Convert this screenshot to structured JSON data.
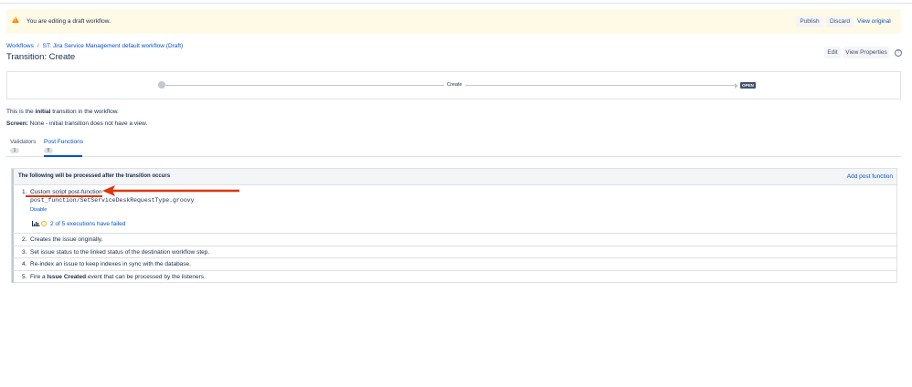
{
  "banner": {
    "text": "You are editing a draft workflow.",
    "publish": "Publish",
    "discard": "Discard",
    "view_original": "View original"
  },
  "breadcrumb": {
    "root": "Workflows",
    "sep": "/",
    "workflow": "ST: Jira Service Management default workflow (Draft)"
  },
  "header": {
    "title": "Transition: Create",
    "edit": "Edit",
    "view_properties": "View Properties",
    "help": "?"
  },
  "diagram": {
    "transition": "Create",
    "status": "OPEN"
  },
  "info": {
    "initial_prefix": "This is the ",
    "initial_bold": "initial",
    "initial_suffix": " transition in the workflow.",
    "screen_label": "Screen:",
    "screen_value": " None - initial transition does not have a view."
  },
  "tabs": [
    {
      "label": "Validators",
      "count": "1"
    },
    {
      "label": "Post Functions",
      "count": "5"
    }
  ],
  "panel": {
    "heading": "The following will be processed after the transition occurs",
    "add": "Add post function",
    "items": [
      {
        "num": "1.",
        "text": "Custom script post-function",
        "file": "post_function/SetServiceDeskRequestType.groovy",
        "disable": "Disable",
        "executions": "2 of 5 executions have failed"
      },
      {
        "num": "2.",
        "text": "Creates the issue originally."
      },
      {
        "num": "3.",
        "text": "Set issue status to the linked status of the destination workflow step."
      },
      {
        "num": "4.",
        "text": "Re-index an issue to keep indexes in sync with the database."
      },
      {
        "num": "5.",
        "text_prefix": "Fire a ",
        "text_bold": "Issue Created",
        "text_suffix": " event that can be processed by the listeners."
      }
    ]
  },
  "colors": {
    "accent": "#0052cc",
    "warning": "#ff8b00",
    "annotation": "#de350b"
  }
}
